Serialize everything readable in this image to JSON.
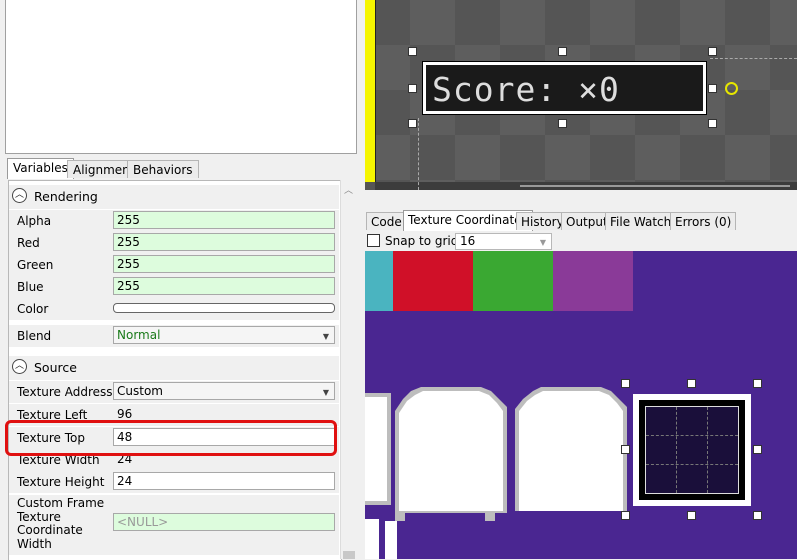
{
  "left_panel": {
    "tabs": [
      "Variables",
      "Alignment",
      "Behaviors"
    ],
    "categories": {
      "rendering": "Rendering",
      "source": "Source"
    },
    "rendering_rows": [
      {
        "name": "Alpha",
        "value": "255"
      },
      {
        "name": "Red",
        "value": "255"
      },
      {
        "name": "Green",
        "value": "255"
      },
      {
        "name": "Blue",
        "value": "255"
      },
      {
        "name": "Color",
        "value": ""
      },
      {
        "name": "Blend",
        "value": "Normal"
      }
    ],
    "source_rows": [
      {
        "name": "Texture Address",
        "value": "Custom"
      },
      {
        "name": "Texture Left",
        "value": "96"
      },
      {
        "name": "Texture Top",
        "value": "48"
      },
      {
        "name": "Texture Width",
        "value": "24"
      },
      {
        "name": "Texture Height",
        "value": "24"
      },
      {
        "name": "Custom Frame Texture Coordinate Width",
        "value": "<NULL>"
      }
    ]
  },
  "game_view": {
    "score_text": "Score: ×0"
  },
  "bottom_tabs": [
    "Code",
    "Texture Coordinates",
    "History",
    "Output",
    "File Watch",
    "Errors (0)"
  ],
  "texture_coordinates": {
    "snap_label": "Snap to grid",
    "snap_value": "16"
  },
  "colors": {
    "highlight": "#e01010",
    "texture_bg": "#4a2691",
    "swatch_cyan": "#4ab4c0",
    "swatch_red": "#d01028",
    "swatch_green": "#3aa832",
    "swatch_magenta": "#8a3a98",
    "ruler": "#f5f500",
    "green_field": "#ddfcdd"
  }
}
